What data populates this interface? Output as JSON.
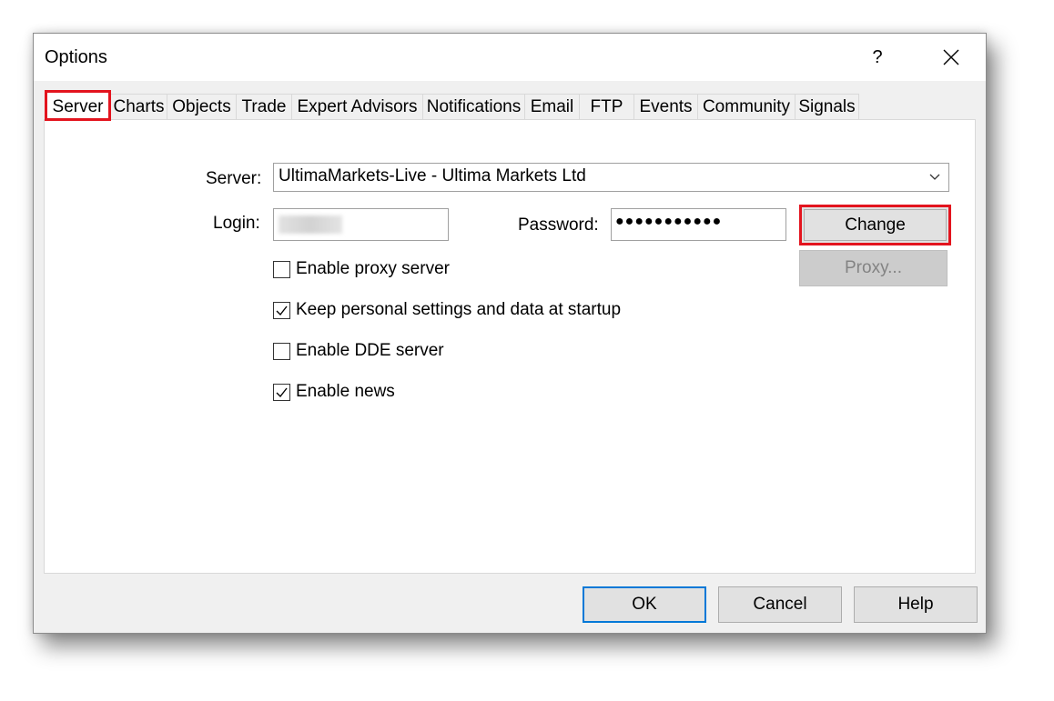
{
  "window": {
    "title": "Options",
    "help_glyph": "?"
  },
  "tabs": [
    {
      "label": "Server",
      "active": true
    },
    {
      "label": "Charts"
    },
    {
      "label": "Objects"
    },
    {
      "label": "Trade"
    },
    {
      "label": "Expert Advisors"
    },
    {
      "label": "Notifications"
    },
    {
      "label": "Email"
    },
    {
      "label": "FTP"
    },
    {
      "label": "Events"
    },
    {
      "label": "Community"
    },
    {
      "label": "Signals"
    }
  ],
  "server": {
    "server_label": "Server:",
    "server_value": "UltimaMarkets-Live - Ultima Markets Ltd",
    "login_label": "Login:",
    "password_label": "Password:",
    "password_mask": "●●●●●●●●●●●",
    "change_label": "Change",
    "proxy_label": "Proxy...",
    "checkboxes": [
      {
        "label": "Enable proxy server",
        "checked": false
      },
      {
        "label": "Keep personal settings and data at startup",
        "checked": true
      },
      {
        "label": "Enable DDE server",
        "checked": false
      },
      {
        "label": "Enable news",
        "checked": true
      }
    ]
  },
  "buttons": {
    "ok": "OK",
    "cancel": "Cancel",
    "help": "Help"
  },
  "colors": {
    "highlight": "#e3141e",
    "default_button_border": "#0078d7"
  }
}
